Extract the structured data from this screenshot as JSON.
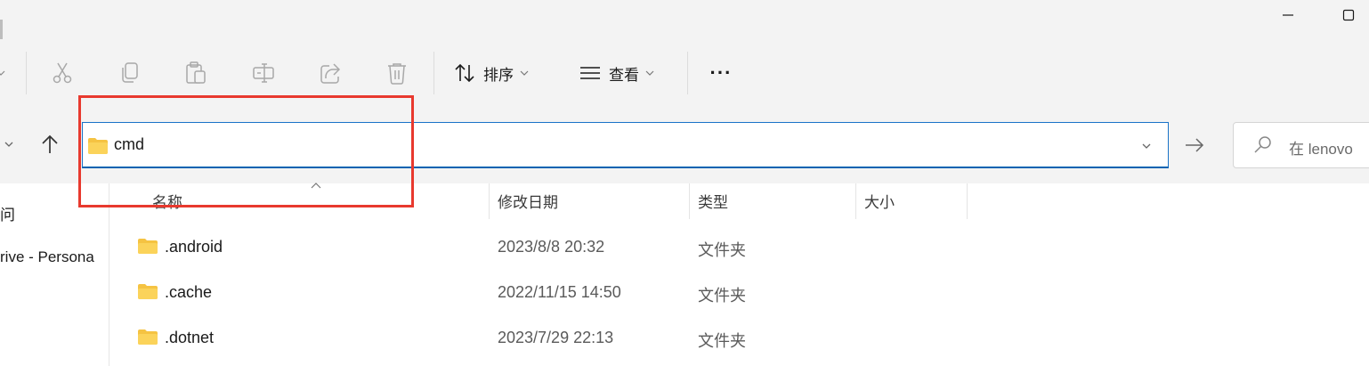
{
  "toolbar": {
    "sort_label": "排序",
    "view_label": "查看",
    "more_label": "···",
    "icons": [
      "cut-icon",
      "copy-icon",
      "paste-icon",
      "rename-icon",
      "share-icon",
      "delete-icon"
    ]
  },
  "address_bar": {
    "path": "cmd"
  },
  "search": {
    "placeholder": "在 lenovo"
  },
  "sidebar": {
    "items": [
      {
        "label": "问"
      },
      {
        "label": "rive - Persona"
      }
    ]
  },
  "columns": [
    {
      "label": "名称"
    },
    {
      "label": "修改日期"
    },
    {
      "label": "类型"
    },
    {
      "label": "大小"
    }
  ],
  "files": [
    {
      "name": ".android",
      "modified": "2023/8/8 20:32",
      "type": "文件夹"
    },
    {
      "name": ".cache",
      "modified": "2022/11/15 14:50",
      "type": "文件夹"
    },
    {
      "name": ".dotnet",
      "modified": "2023/7/29 22:13",
      "type": "文件夹"
    }
  ],
  "colors": {
    "accent": "#0063b1",
    "highlight": "#e8392e",
    "folder": "#f5c342"
  }
}
